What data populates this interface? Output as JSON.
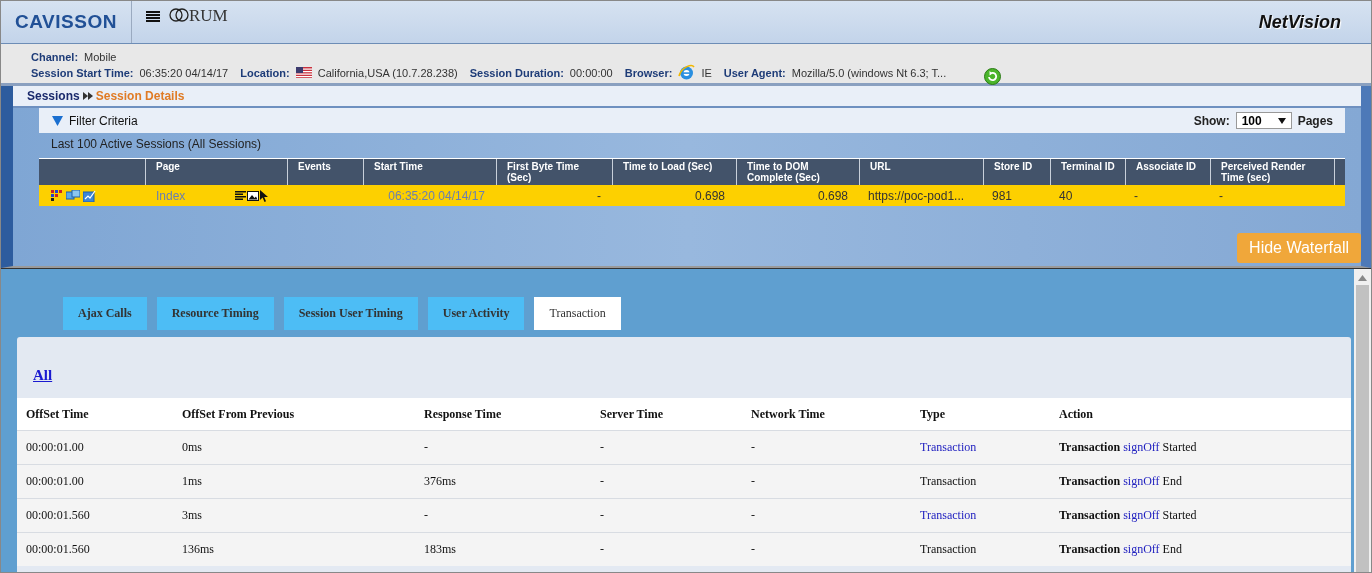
{
  "header": {
    "logo": "CAVISSON",
    "product": "RUM",
    "brand": "NetVision"
  },
  "session_info": {
    "channel_label": "Channel:",
    "channel": "Mobile",
    "fields": [
      {
        "label": "Session Start Time:",
        "value": "06:35:20 04/14/17"
      },
      {
        "label": "Location:",
        "value": "California,USA (10.7.28.238)",
        "kind": "flag"
      },
      {
        "label": "Session Duration:",
        "value": "00:00:00"
      },
      {
        "label": "Browser:",
        "value": "IE",
        "kind": "browser"
      },
      {
        "label": "User Agent:",
        "value": "Mozilla/5.0 (windows Nt 6.3; T..."
      }
    ]
  },
  "breadcrumb": [
    {
      "label": "Sessions",
      "selected": false
    },
    {
      "label": "Session Details",
      "selected": true
    }
  ],
  "filter": {
    "title": "Filter Criteria",
    "expanded": true,
    "show_label": "Show:",
    "show_value": "100",
    "pages_label": "Pages"
  },
  "sessions_caption": "Last 100 Active Sessions (All Sessions)",
  "sessions_table": {
    "columns": [
      "",
      "Page",
      "Events",
      "Start Time",
      "First Byte Time (Sec)",
      "Time to Load (Sec)",
      "Time to DOM Complete (Sec)",
      "URL",
      "Store ID",
      "Terminal ID",
      "Associate ID",
      "Perceived Render Time (sec)"
    ],
    "rows": [
      {
        "selected": true,
        "cells": [
          "",
          "Index",
          "",
          "06:35:20 04/14/17",
          "-",
          "0.698",
          "0.698",
          "https://poc-pod1...",
          "981",
          "40",
          "-",
          "-"
        ]
      }
    ]
  },
  "hide_waterfall": "Hide Waterfall",
  "tabs": [
    {
      "label": "Ajax Calls",
      "selected": false
    },
    {
      "label": "Resource Timing",
      "selected": false
    },
    {
      "label": "Session User Timing",
      "selected": false
    },
    {
      "label": "User Activity",
      "selected": false
    },
    {
      "label": "Transaction",
      "selected": true
    }
  ],
  "filter_link": "All",
  "transactions": {
    "columns": [
      "OffSet Time",
      "OffSet From Previous",
      "Response Time",
      "Server Time",
      "Network Time",
      "Type",
      "Action"
    ],
    "rows": [
      {
        "offset": "00:00:01.00",
        "from_previous": "0ms",
        "response": "-",
        "server": "-",
        "network": "-",
        "type": "Transaction",
        "type_link": true,
        "action": {
          "name": "Transaction",
          "link": "signOff",
          "status": "Started"
        }
      },
      {
        "offset": "00:00:01.00",
        "from_previous": "1ms",
        "response": "376ms",
        "server": "-",
        "network": "-",
        "type": "Transaction",
        "type_link": false,
        "action": {
          "name": "Transaction",
          "link": "signOff",
          "status": "End"
        }
      },
      {
        "offset": "00:00:01.560",
        "from_previous": "3ms",
        "response": "-",
        "server": "-",
        "network": "-",
        "type": "Transaction",
        "type_link": true,
        "action": {
          "name": "Transaction",
          "link": "signOff",
          "status": "Started"
        }
      },
      {
        "offset": "00:00:01.560",
        "from_previous": "136ms",
        "response": "183ms",
        "server": "-",
        "network": "-",
        "type": "Transaction",
        "type_link": false,
        "action": {
          "name": "Transaction",
          "link": "signOff",
          "status": "End"
        }
      }
    ]
  }
}
